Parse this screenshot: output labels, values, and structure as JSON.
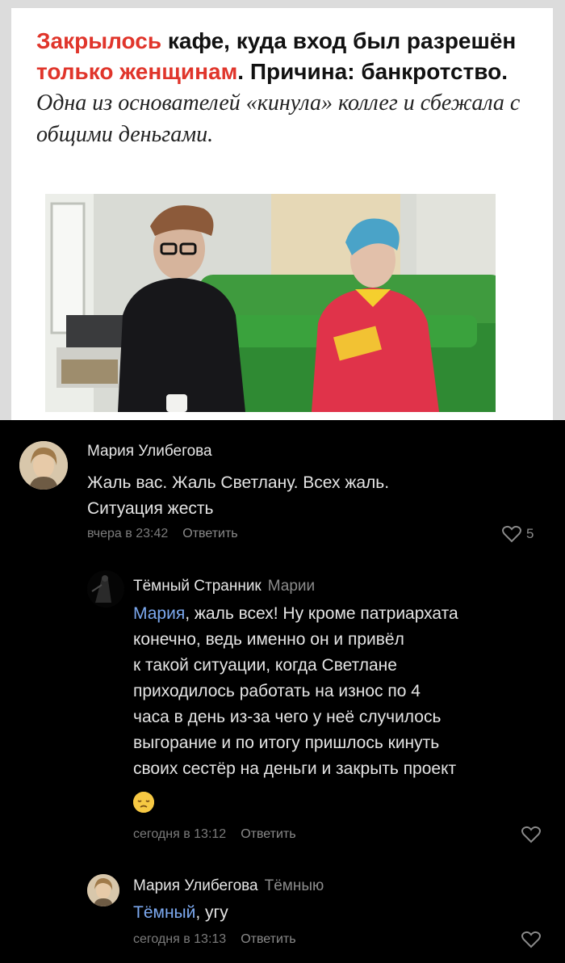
{
  "article": {
    "headline_parts": {
      "p1_red": "Закрылось",
      "p2": " кафе, куда вход был разрешён ",
      "p3_red": "только женщинам",
      "p4": ". Причина: банкротство. ",
      "p5_italic": "Одна из основателей «кинула» коллег и сбежала с общими деньгами."
    }
  },
  "comments": [
    {
      "author": "Мария Улибегова",
      "reply_to": "",
      "text_lines": [
        "Жаль вас. Жаль Светлану. Всех жаль.",
        "Ситуация жесть"
      ],
      "time": "вчера в 23:42",
      "reply_label": "Ответить",
      "likes": "5"
    },
    {
      "author": "Тёмный Странник",
      "reply_to": "Марии",
      "mention": "Мария",
      "text_first": ", жаль всех! Ну кроме патриархата",
      "text_lines": [
        "конечно, ведь именно он и привёл",
        "к такой ситуации, когда Светлане",
        "приходилось работать на износ по 4",
        "часа в день из-за чего у неё случилось",
        "выгорание и по итогу пришлось кинуть",
        "своих сестёр на деньги и закрыть проект"
      ],
      "emoji": "sad-face-emoji",
      "time": "сегодня в 13:12",
      "reply_label": "Ответить"
    },
    {
      "author": "Мария Улибегова",
      "reply_to": "Тёмныю",
      "mention": "Тёмный",
      "text_first": ", угу",
      "time": "сегодня в 13:13",
      "reply_label": "Ответить"
    }
  ],
  "colors": {
    "accent_red": "#e0352b",
    "mention_blue": "#7ca9f0",
    "background": "#000000"
  }
}
